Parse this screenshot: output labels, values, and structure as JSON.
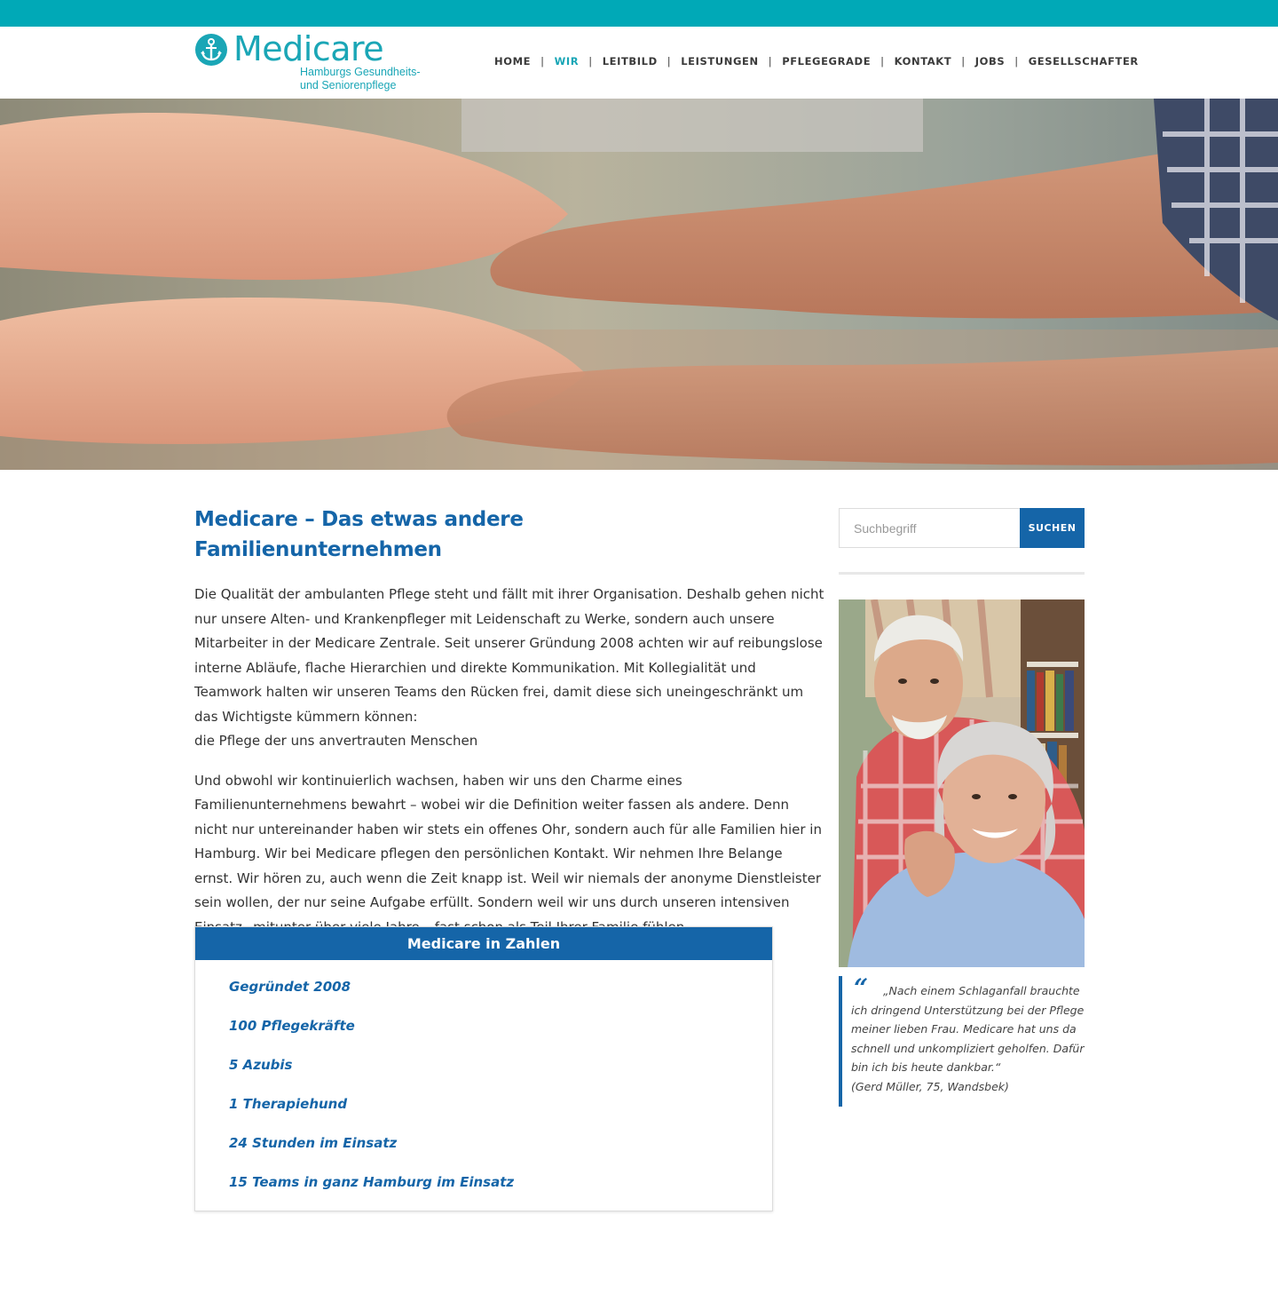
{
  "brand": {
    "name": "Medicare",
    "tagline_line1": "Hamburgs Gesundheits-",
    "tagline_line2": "und Seniorenpflege",
    "accent_color": "#1aa6b6",
    "primary_color": "#1565a8"
  },
  "nav": {
    "items": [
      {
        "label": "HOME"
      },
      {
        "label": "WIR",
        "active": true
      },
      {
        "label": "LEITBILD"
      },
      {
        "label": "LEISTUNGEN"
      },
      {
        "label": "PFLEGEGRADE"
      },
      {
        "label": "KONTAKT"
      },
      {
        "label": "JOBS"
      },
      {
        "label": "GESELLSCHAFTER"
      }
    ],
    "separator": "|"
  },
  "main": {
    "title": "Medicare – Das etwas andere Familienunternehmen",
    "paragraph1": [
      "Die Qualität der ambulanten Pflege steht und fällt mit ihrer Organisation. Deshalb gehen nicht",
      "nur unsere Alten- und Krankenpfleger mit Leidenschaft zu Werke, sondern auch unsere",
      "Mitarbeiter in der Medicare Zentrale. Seit unserer Gründung 2008 achten wir auf reibungslose",
      "interne Abläufe, flache Hierarchien und direkte Kommunikation. Mit Kollegialität und",
      "Teamwork halten wir unseren Teams den Rücken frei, damit diese sich uneingeschränkt um",
      "das Wichtigste kümmern können:",
      "die Pflege der uns anvertrauten Menschen"
    ],
    "paragraph2": [
      "Und obwohl wir kontinuierlich wachsen, haben wir uns den Charme eines",
      "Familienunternehmens bewahrt – wobei wir die Definition weiter fassen als andere. Denn",
      "nicht nur untereinander haben wir stets ein offenes Ohr, sondern auch für alle Familien hier in",
      "Hamburg. Wir bei Medicare pflegen den persönlichen Kontakt. Wir nehmen Ihre Belange",
      "ernst. Wir hören zu, auch wenn die Zeit knapp ist. Weil wir niemals der anonyme Dienstleister",
      "sein wollen, der nur seine Aufgabe erfüllt. Sondern weil wir uns durch unseren intensiven",
      "Einsatz– mitunter über viele Jahre – fast schon als Teil Ihrer Familie fühlen."
    ]
  },
  "facts": {
    "title": "Medicare in Zahlen",
    "items": [
      "Gegründet 2008",
      "100 Pflegekräfte",
      "5 Azubis",
      "1 Therapiehund",
      "24 Stunden im Einsatz",
      "15 Teams in ganz Hamburg im Einsatz"
    ]
  },
  "sidebar": {
    "search_placeholder": "Suchbegriff",
    "search_button": "SUCHEN",
    "quote_mark": "“",
    "quote_lines": [
      "„Nach einem Schlaganfall brauchte",
      "ich dringend Unterstützung bei der Pflege",
      "meiner lieben Frau. Medicare hat uns da",
      "schnell und unkompliziert geholfen. Dafür",
      "bin ich bis heute dankbar.“"
    ],
    "quote_author": "(Gerd Müller, 75, Wandsbek)"
  }
}
